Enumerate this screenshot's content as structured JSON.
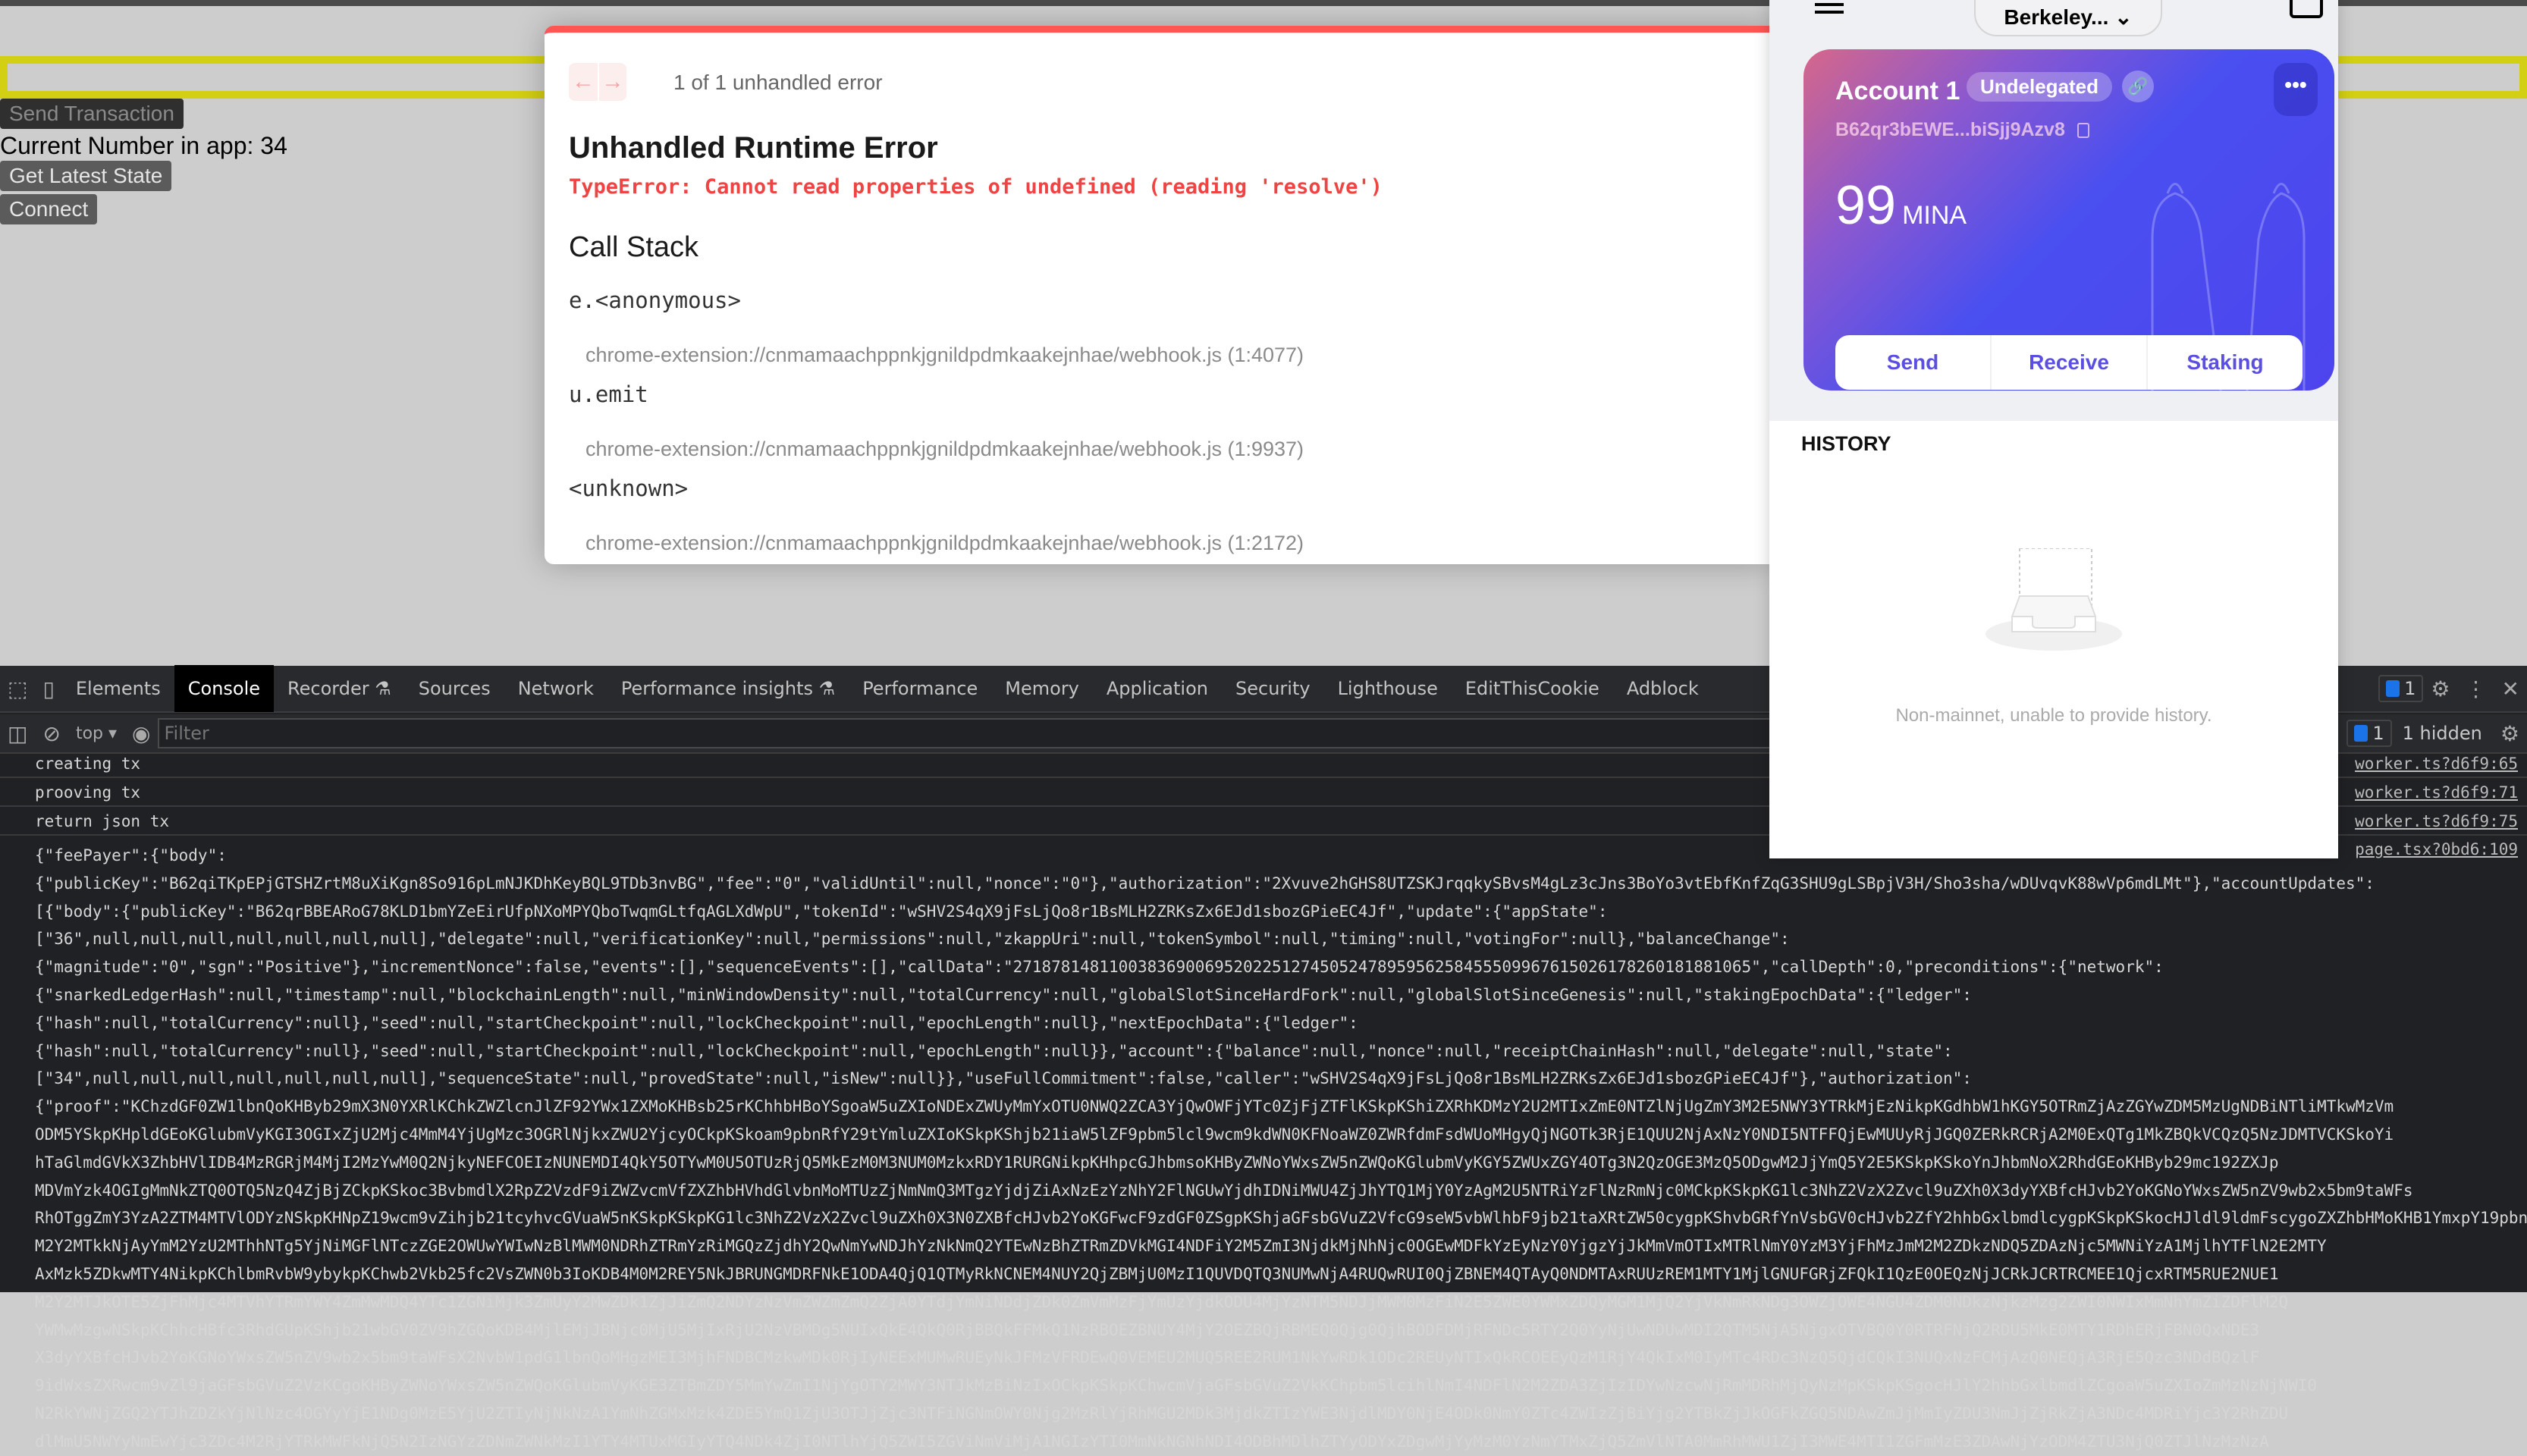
{
  "app": {
    "send_transaction": "Send Transaction",
    "current_number": "Current Number in app: 34",
    "get_latest_state": "Get Latest State",
    "connect": "Connect",
    "input_color": "#d3cf12"
  },
  "error_overlay": {
    "counter": "1 of 1 unhandled error",
    "title": "Unhandled Runtime Error",
    "message": "TypeError: Cannot read properties of undefined (reading 'resolve')",
    "call_stack_title": "Call Stack",
    "frames": [
      {
        "fn": "e.<anonymous>",
        "loc": "chrome-extension://cnmamaachppnkjgnildpdmkaakejnhae/webhook.js (1:4077)"
      },
      {
        "fn": "u.emit",
        "loc": "chrome-extension://cnmamaachppnkjgnildpdmkaakejnhae/webhook.js (1:9937)"
      },
      {
        "fn": "<unknown>",
        "loc": "chrome-extension://cnmamaachppnkjgnildpdmkaakejnhae/webhook.js (1:2172)"
      }
    ],
    "accent": "#ff5555"
  },
  "wallet": {
    "network": "Berkeley...",
    "account_name": "Account 1",
    "status_badge": "Undelegated",
    "address": "B62qr3bEWE...biSjj9Azv8",
    "balance": "99",
    "unit": "MINA",
    "actions": [
      "Send",
      "Receive",
      "Staking"
    ],
    "history_title": "HISTORY",
    "history_empty": "Non-mainnet, unable to provide history."
  },
  "devtools": {
    "tabs": [
      "Elements",
      "Console",
      "Recorder ⚗",
      "Sources",
      "Network",
      "Performance insights ⚗",
      "Performance",
      "Memory",
      "Application",
      "Security",
      "Lighthouse",
      "EditThisCookie",
      "Adblock"
    ],
    "active_tab": "Console",
    "issues_count": "1",
    "context": "top ▾",
    "filter_placeholder": "Filter",
    "messages_count": "1",
    "hidden": "1 hidden",
    "logs": [
      {
        "text": "creating tx",
        "source": "worker.ts?d6f9:65"
      },
      {
        "text": "prooving tx",
        "source": "worker.ts?d6f9:71"
      },
      {
        "text": "return json tx",
        "source": "worker.ts?d6f9:75"
      }
    ],
    "json_source": "page.tsx?0bd6:109",
    "json_lines": [
      "{\"feePayer\":{\"body\":",
      "{\"publicKey\":\"B62qiTKpEPjGTSHZrtM8uXiKgn8So916pLmNJKDhKeyBQL9TDb3nvBG\",\"fee\":\"0\",\"validUntil\":null,\"nonce\":\"0\"},\"authorization\":\"2Xvuve2hGHS8UTZSKJrqqkySBvsM4gLz3cJns3BoYo3vtEbfKnfZqG3SHU9gLSBpjV3H/Sho3sha/wDUvqvK88wVp6mdLMt\"},\"accountUpdates\":",
      "[{\"body\":{\"publicKey\":\"B62qrBBEARoG78KLD1bmYZeEirUfpNXoMPYQboTwqmGLtfqAGLXdWpU\",\"tokenId\":\"wSHV2S4qX9jFsLjQo8r1BsMLH2ZRKsZx6EJd1sbozGPieEC4Jf\",\"update\":{\"appState\":",
      "[\"36\",null,null,null,null,null,null,null],\"delegate\":null,\"verificationKey\":null,\"permissions\":null,\"zkappUri\":null,\"tokenSymbol\":null,\"timing\":null,\"votingFor\":null},\"balanceChange\":",
      "{\"magnitude\":\"0\",\"sgn\":\"Positive\"},\"incrementNonce\":false,\"events\":[],\"sequenceEvents\":[],\"callData\":\"27187814811003836900695202251274505247895956258455509967615026178260181881065\",\"callDepth\":0,\"preconditions\":{\"network\":",
      "{\"snarkedLedgerHash\":null,\"timestamp\":null,\"blockchainLength\":null,\"minWindowDensity\":null,\"totalCurrency\":null,\"globalSlotSinceHardFork\":null,\"globalSlotSinceGenesis\":null,\"stakingEpochData\":{\"ledger\":",
      "{\"hash\":null,\"totalCurrency\":null},\"seed\":null,\"startCheckpoint\":null,\"lockCheckpoint\":null,\"epochLength\":null},\"nextEpochData\":{\"ledger\":",
      "{\"hash\":null,\"totalCurrency\":null},\"seed\":null,\"startCheckpoint\":null,\"lockCheckpoint\":null,\"epochLength\":null}},\"account\":{\"balance\":null,\"nonce\":null,\"receiptChainHash\":null,\"delegate\":null,\"state\":",
      "[\"34\",null,null,null,null,null,null,null],\"sequenceState\":null,\"provedState\":null,\"isNew\":null}},\"useFullCommitment\":false,\"caller\":\"wSHV2S4qX9jFsLjQo8r1BsMLH2ZRKsZx6EJd1sbozGPieEC4Jf\"},\"authorization\":",
      "{\"proof\":\"KChzdGF0ZW1lbnQoKHByb29mX3N0YXRlKChkZWZlcnJlZF92YWx1ZXMoKHBsb25rKChhbHBoYSgoaW5uZXIoNDExZWUyMmYxOTU0NWQ2ZCA3YjQwOWFjYTc0ZjFjZTFlKSkpKShiZXRhKDMzY2U2MTIxZmE0NTZlNjUgZmY3M2E5NWY3YTRkMjEzNikpKGdhbW1hKGY5OTRmZjAzZGYwZDM5MzUgNDBiNTliMTkwMzVm",
      "ODM5YSkpKHpldGEoKGlubmVyKGI3OGIxZjU2Mjc4MmM4YjUgMzc3OGRlNjkxZWU2YjcyOCkpKSkoam9pbnRfY29tYmluZXIoKSkpKShjb21iaW5lZF9pbm5lcl9wcm9kdWN0KFNoaWZ0ZWRfdmFsdWUoMHgyQjNGOTk3RjE1QUU2NjAxNzY0NDI5NTFFQjEwMUUyRjJGQ0ZERkRCRjA2M0ExQTg1MkZBQkVCQzQ5NzJDMTVCKSkoYi",
      "hTaGlmdGVkX3ZhbHVlIDB4MzRGRjM4MjI2MzYwM0Q2NjkyNEFCOEIzNUNEMDI4QkY5OTYwM0U5OTUzRjQ5MkEzM0M3NUM0MzkxRDY1RURGNikpKHhpcGJhbmsoKHByZWNoYWxsZW5nZWQoKGlubmVyKGY5ZWUxZGY4OTg3N2QzOGE3MzQ5ODgwM2JjYmQ5Y2E5KSkpKSkoYnJhbmNoX2RhdGEoKHByb29mc192ZXJp",
      "MDVmYzk4OGIgMmNkZTQ0OTQ5NzQ4ZjBjZCkpKSkoc3BvbmdlX2RpZ2VzdF9iZWZvcmVfZXZhbHVhdGlvbnMoMTUzZjNmNmQ3MTgzYjdjZiAxNzEzYzNhY2FlNGUwYjdhIDNiMWU4ZjJhYTQ1MjY0YzAgM2U5NTRiYzFlNzRmNjc0MCkpKSkpKG1lc3NhZ2VzX2Zvcl9uZXh0X3dyYXBfcHJvb2YoKGNoYWxsZW5nZV9wb2x5bm9taWFs",
      "RhOTggZmY3YzA2ZTM4MTVlODYzNSkpKHNpZ19wcm9vZihjb21tcyhvcGVuaW5nKSkpKSkpKG1lc3NhZ2VzX2Zvcl9uZXh0X3N0ZXBfcHJvb2YoKGFwcF9zdGF0ZSgpKShjaGFsbGVuZ2VfcG9seW5vbWlhbF9jb21taXRtZW50cygpKShvbGRfYnVsbGV0cHJvb2ZfY2hhbGxlbmdlcygpKSkpKSkocHJldl9ldmFscygoZXZhbHMoKHB1YmxpY19pbnB1dCgw",
      "M2Y2MTkkNjAyYmM2YzU2MThhNTg5YjNiMGFlNTczZGE2OWUwYWIwNzBlMWM0NDRhZTRmYzRiMGQzZjdhY2QwNmYwNDJhYzNkNmQ2YTEwNzBhZTRmZDVkMGI4NDFiY2M5ZmI3NjdkMjNhNjc0OGEwMDFkYzEyNzY0YjgzYjJkMmVmOTIxMTRlNmY0YzM3YjFhMzJmM2M2ZDkzNDQ5ZDAzNjc5MWNiYzA1MjlhYTFlN2E2MTY",
      "AxMzk5ZDkwMTY4NikpKChlbmRvbW9ybykpKChwb2Vkb25fc2VsZWN0b3IoKDB4M0M2REY5NkJBRUNGMDRFNkE1ODA4QjQ1QTMyRkNCNEM4NUY2QjZBMjU0MzI1QUVDQTQ3NUMwNjA4RUQwRUI0QjZBNEM4QTAyQ0NDMTAxRUUzREM1MTY1MjlGNUFGRjZFQkI1QzE0OEQzNjJCRkJCRTRCMEE1QjcxRTM5RUE2NUE1",
      "M2Y2MTJkOTE5ZjFhMjc4MTVhYTRmYWY4ZmMwMDQ4YTc1ZGNiMjk3ZmUyY2MwZDk1ZjJiZmQ2NDYzNzVmZWZmZmQ2ZjA0YTdjYmNiNDdjZDk0ZmVmMzFjYmUzYjdkODU4MjYzNTM5NDJjMWM0MzFiN2E5ZWE0YWMxZDQyMGM1MjQ2YjVkNmRkNDg3OWZjOWE4NGU4ZDM0NDkzNjkzMzg2ZWI0NWIxMmNhYmZiZDFlM2Q",
      "YWMwMzgwNSkpKChhcHBfc3RhdGUpKShjb21wbGV0ZV9hZGQoKDB4MjlEMjJBNjc0MjU5MjIxRjU2NzVBMDg5NUIxQkE4QkQ0RjBBQkFFMkQ1NzRBOEZBNUY4MjY2OEZBQjRBMEQ0Qjg0QjhBODFDMjRFNDc5RTY2Q0YyNjUwNDUwMDI2QTM5NjA5NjgxOTVBQ0Y0RTRFNjQ2RDU5MkE0MTY1RDhERjFBN0QxNDE3",
      "X3dyYXBfcHJvb2YoKGNoYWxsZW5nZV9wb2x5bm9taWFsX2NvbW1pdG1lbnQoMHgzMEI3MjhFNDBCMzkwMDk0RjIyNEExMUMwRUEyNkJFMzVFRDEwQ0VEMEU2MUQ5REE2RUM1NkYwRDk1ODc2REUyNTIxQkRCOEEyQzM1RjY4QkIxM0IyMTc4RDc3NzQ5QjdCQkI3NUQxNzFCMjAzQ0NEQjA3RjE5Qzc3NDdBQzlF",
      "9idWxsZXRwcm9vZl9jaGFsbGVuZ2VzKCgoKHByZWNoYWxsZW5nZWQoKGlubmVyKGE3ZTBmZDY5MmYwZmI1NjYgOTY2MWY3NTJkMzBiNzIxOCkpKSkpKChwcmVjaGFsbGVuZ2VkKChpbm5lcihlNmI4NDFlN2M2ZDA3ZjIzIDYwNzcwNjRmMDRhMjQyNzMpKSkpKSgocHJlY2hhbGxlbmdlZCgoaW5uZXIoZmMzNzNjNWI0",
      "N2RkYWNjZGQ2YTJhZDZkYjNlNzc4OGYyYjE1NDg0MzE5YjU2ZTIyNjNkNzA1YmNhZGMxMzk4ZDE5YmQ1ZjU3OTJjZjc3NTFiNGNmOWY0Njg2MzRlYjRhMGU2MDk3MjdkZTIzYWE3NjdlMDY0NjE4ODk0NmY0ZTc4ZWIzZjBiYjg2YTBkZjJkOGFkZGQ5NDAwZmJjMmIyZDU3NmJjZjRkZjA3NDc4MDRiYjc3Y2RhZDU",
      "dlMmU5NWYyNmEwYjc3ZDc4M2RjYTRkMWFkNjQ5N2IzNGYzZDNmZWNkMzI1YTY4MTUxMGIyYTQ4NDk4ZjI0NTlhYjQ5ZWI5ZGViNmViMjA1NGIzYTI0MmNkNGNhNDI4ODBhMDlhZTYyODYxZDgwMjYyMzM0YzNmYTMxZjQ5ZmVlNTA0MmRhMWU1ZjI3MWE4MTI1ZGFmMzE3ZDAwNjYzODM4ZTU3NjQ0ZTJlNzMzNzA"
    ]
  }
}
